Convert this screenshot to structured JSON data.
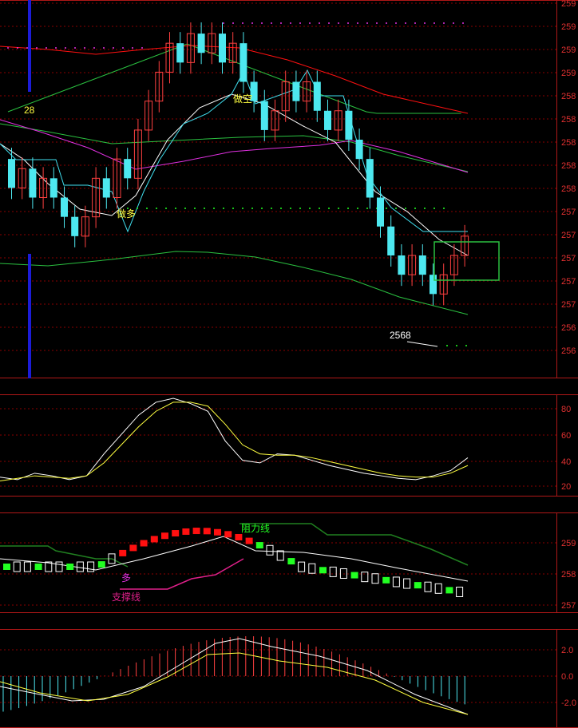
{
  "colors": {
    "background": "#000000",
    "border": "#b01818",
    "grid": "#8b0000",
    "up": "#ff4040",
    "down": "#4de8f0",
    "green_band": "#2ac040",
    "magenta": "#e030e0",
    "white": "#ffffff",
    "yellow": "#ffff40",
    "cyan_line": "#40e0f0",
    "blue_marker": "#1c1cd8",
    "bright_green": "#22ff22",
    "bright_red": "#ff1010",
    "support": "#e0208a",
    "resistance": "#208020"
  },
  "chart_data": [
    {
      "type": "candlestick",
      "panel": "price",
      "ytick_labels": [
        "259",
        "259",
        "259",
        "259",
        "258",
        "258",
        "258",
        "258",
        "258",
        "257",
        "257",
        "257",
        "257",
        "257",
        "256",
        "256"
      ],
      "ytick_first": "259",
      "annotations": {
        "count_label": "28",
        "short_signal": "做空",
        "long_signal": "做多",
        "low_label": "2568"
      },
      "candles": [
        {
          "o": 2582,
          "c": 2579
        },
        {
          "o": 2579,
          "c": 2581
        },
        {
          "o": 2581,
          "c": 2578
        },
        {
          "o": 2578,
          "c": 2580
        },
        {
          "o": 2580,
          "c": 2578
        },
        {
          "o": 2578,
          "c": 2576
        },
        {
          "o": 2576,
          "c": 2574
        },
        {
          "o": 2574,
          "c": 2576
        },
        {
          "o": 2576,
          "c": 2580
        },
        {
          "o": 2580,
          "c": 2578
        },
        {
          "o": 2578,
          "c": 2582
        },
        {
          "o": 2582,
          "c": 2580
        },
        {
          "o": 2580,
          "c": 2585
        },
        {
          "o": 2585,
          "c": 2588
        },
        {
          "o": 2588,
          "c": 2591
        },
        {
          "o": 2591,
          "c": 2594
        },
        {
          "o": 2594,
          "c": 2592
        },
        {
          "o": 2592,
          "c": 2595
        },
        {
          "o": 2595,
          "c": 2593
        },
        {
          "o": 2593,
          "c": 2595
        },
        {
          "o": 2595,
          "c": 2592
        },
        {
          "o": 2592,
          "c": 2594
        },
        {
          "o": 2594,
          "c": 2590
        },
        {
          "o": 2590,
          "c": 2588
        },
        {
          "o": 2588,
          "c": 2585
        },
        {
          "o": 2585,
          "c": 2587
        },
        {
          "o": 2587,
          "c": 2590
        },
        {
          "o": 2590,
          "c": 2588
        },
        {
          "o": 2588,
          "c": 2590
        },
        {
          "o": 2590,
          "c": 2587
        },
        {
          "o": 2587,
          "c": 2585
        },
        {
          "o": 2585,
          "c": 2587
        },
        {
          "o": 2587,
          "c": 2584
        },
        {
          "o": 2584,
          "c": 2582
        },
        {
          "o": 2582,
          "c": 2578
        },
        {
          "o": 2578,
          "c": 2575
        },
        {
          "o": 2575,
          "c": 2572
        },
        {
          "o": 2572,
          "c": 2570
        },
        {
          "o": 2570,
          "c": 2572
        },
        {
          "o": 2572,
          "c": 2570
        },
        {
          "o": 2570,
          "c": 2568
        },
        {
          "o": 2568,
          "c": 2570
        },
        {
          "o": 2570,
          "c": 2572
        },
        {
          "o": 2572,
          "c": 2574
        }
      ]
    },
    {
      "type": "line",
      "panel": "oscillator",
      "ytick_labels": [
        "80",
        "60",
        "40",
        "20"
      ],
      "series": [
        {
          "color": "white",
          "values": [
            27,
            25,
            30,
            28,
            25,
            28,
            45,
            60,
            75,
            85,
            88,
            84,
            78,
            55,
            40,
            38,
            45,
            44,
            40,
            36,
            33,
            30,
            28,
            26,
            25,
            28,
            32,
            42
          ]
        },
        {
          "color": "yellow",
          "values": [
            24,
            26,
            28,
            27,
            26,
            28,
            38,
            52,
            66,
            78,
            85,
            85,
            82,
            68,
            52,
            45,
            44,
            44,
            42,
            39,
            36,
            33,
            30,
            28,
            27,
            27,
            30,
            36
          ]
        }
      ]
    },
    {
      "type": "candlestick",
      "panel": "channel",
      "ytick_labels": [
        "259",
        "258",
        "257"
      ],
      "annotations": {
        "resistance": "阻力线",
        "support": "支撑线",
        "long": "多"
      }
    },
    {
      "type": "bar",
      "panel": "macd",
      "ytick_labels": [
        "2.0",
        "0.0",
        "-2.0"
      ]
    }
  ]
}
